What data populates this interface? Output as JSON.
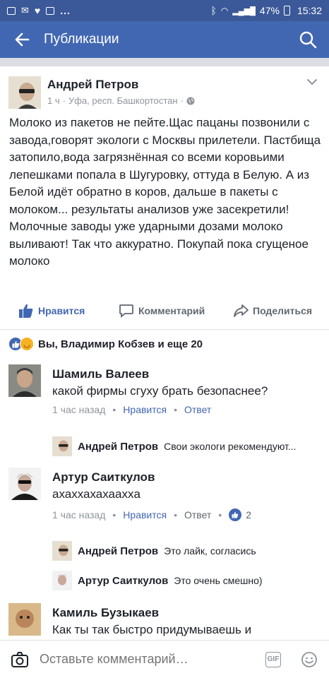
{
  "status_bar": {
    "battery": "47%",
    "time": "15:32",
    "dots": "..."
  },
  "app_bar": {
    "title": "Публикации"
  },
  "post": {
    "author": "Андрей Петров",
    "time": "1 ч",
    "location": "Уфа, респ. Башкортостан",
    "text": "Молоко из пакетов не пейте.Щас пацаны позвонили с завода,говорят экологи с Москвы прилетели. Пастбища затопило,вода загрязнённая со всеми коровьими лепешками попала в Шугуровку, оттуда в Белую. А из Белой идёт обратно в коров, дальше в пакеты с молоком... результаты анализов уже засекретили! Молочные заводы уже ударными дозами молоко выливают! Так что аккуратно. Покупай пока сгущеное молоко",
    "actions": {
      "like": "Нравится",
      "comment": "Комментарий",
      "share": "Поделиться"
    }
  },
  "reactions": {
    "summary": "Вы, Владимир Кобзев и еще 20"
  },
  "comments": [
    {
      "name": "Шамиль Валеев",
      "text": "какой фирмы сгуху брать безопаснее?",
      "time": "1 час назад",
      "like": "Нравится",
      "reply": "Ответ",
      "replies": [
        {
          "name": "Андрей Петров",
          "text": "Свои экологи рекомендуют..."
        }
      ]
    },
    {
      "name": "Артур Саиткулов",
      "text": "ахаххахахааххa",
      "time": "1 час назад",
      "like": "Нравится",
      "reply": "Ответ",
      "like_count": "2",
      "replies": [
        {
          "name": "Андрей Петров",
          "text": "Это лайк, согласись"
        },
        {
          "name": "Артур Саиткулов",
          "text": "Это очень смешно)"
        }
      ]
    },
    {
      "name": "Камиль Бузыкаев",
      "text": "Как ты так быстро придумываешь и"
    }
  ],
  "composer": {
    "placeholder": "Оставьте комментарий…",
    "gif": "GIF"
  },
  "colors": {
    "brand": "#4267b2",
    "status_bar": "#3b5998",
    "text": "#1d2129",
    "muted": "#90949c"
  }
}
